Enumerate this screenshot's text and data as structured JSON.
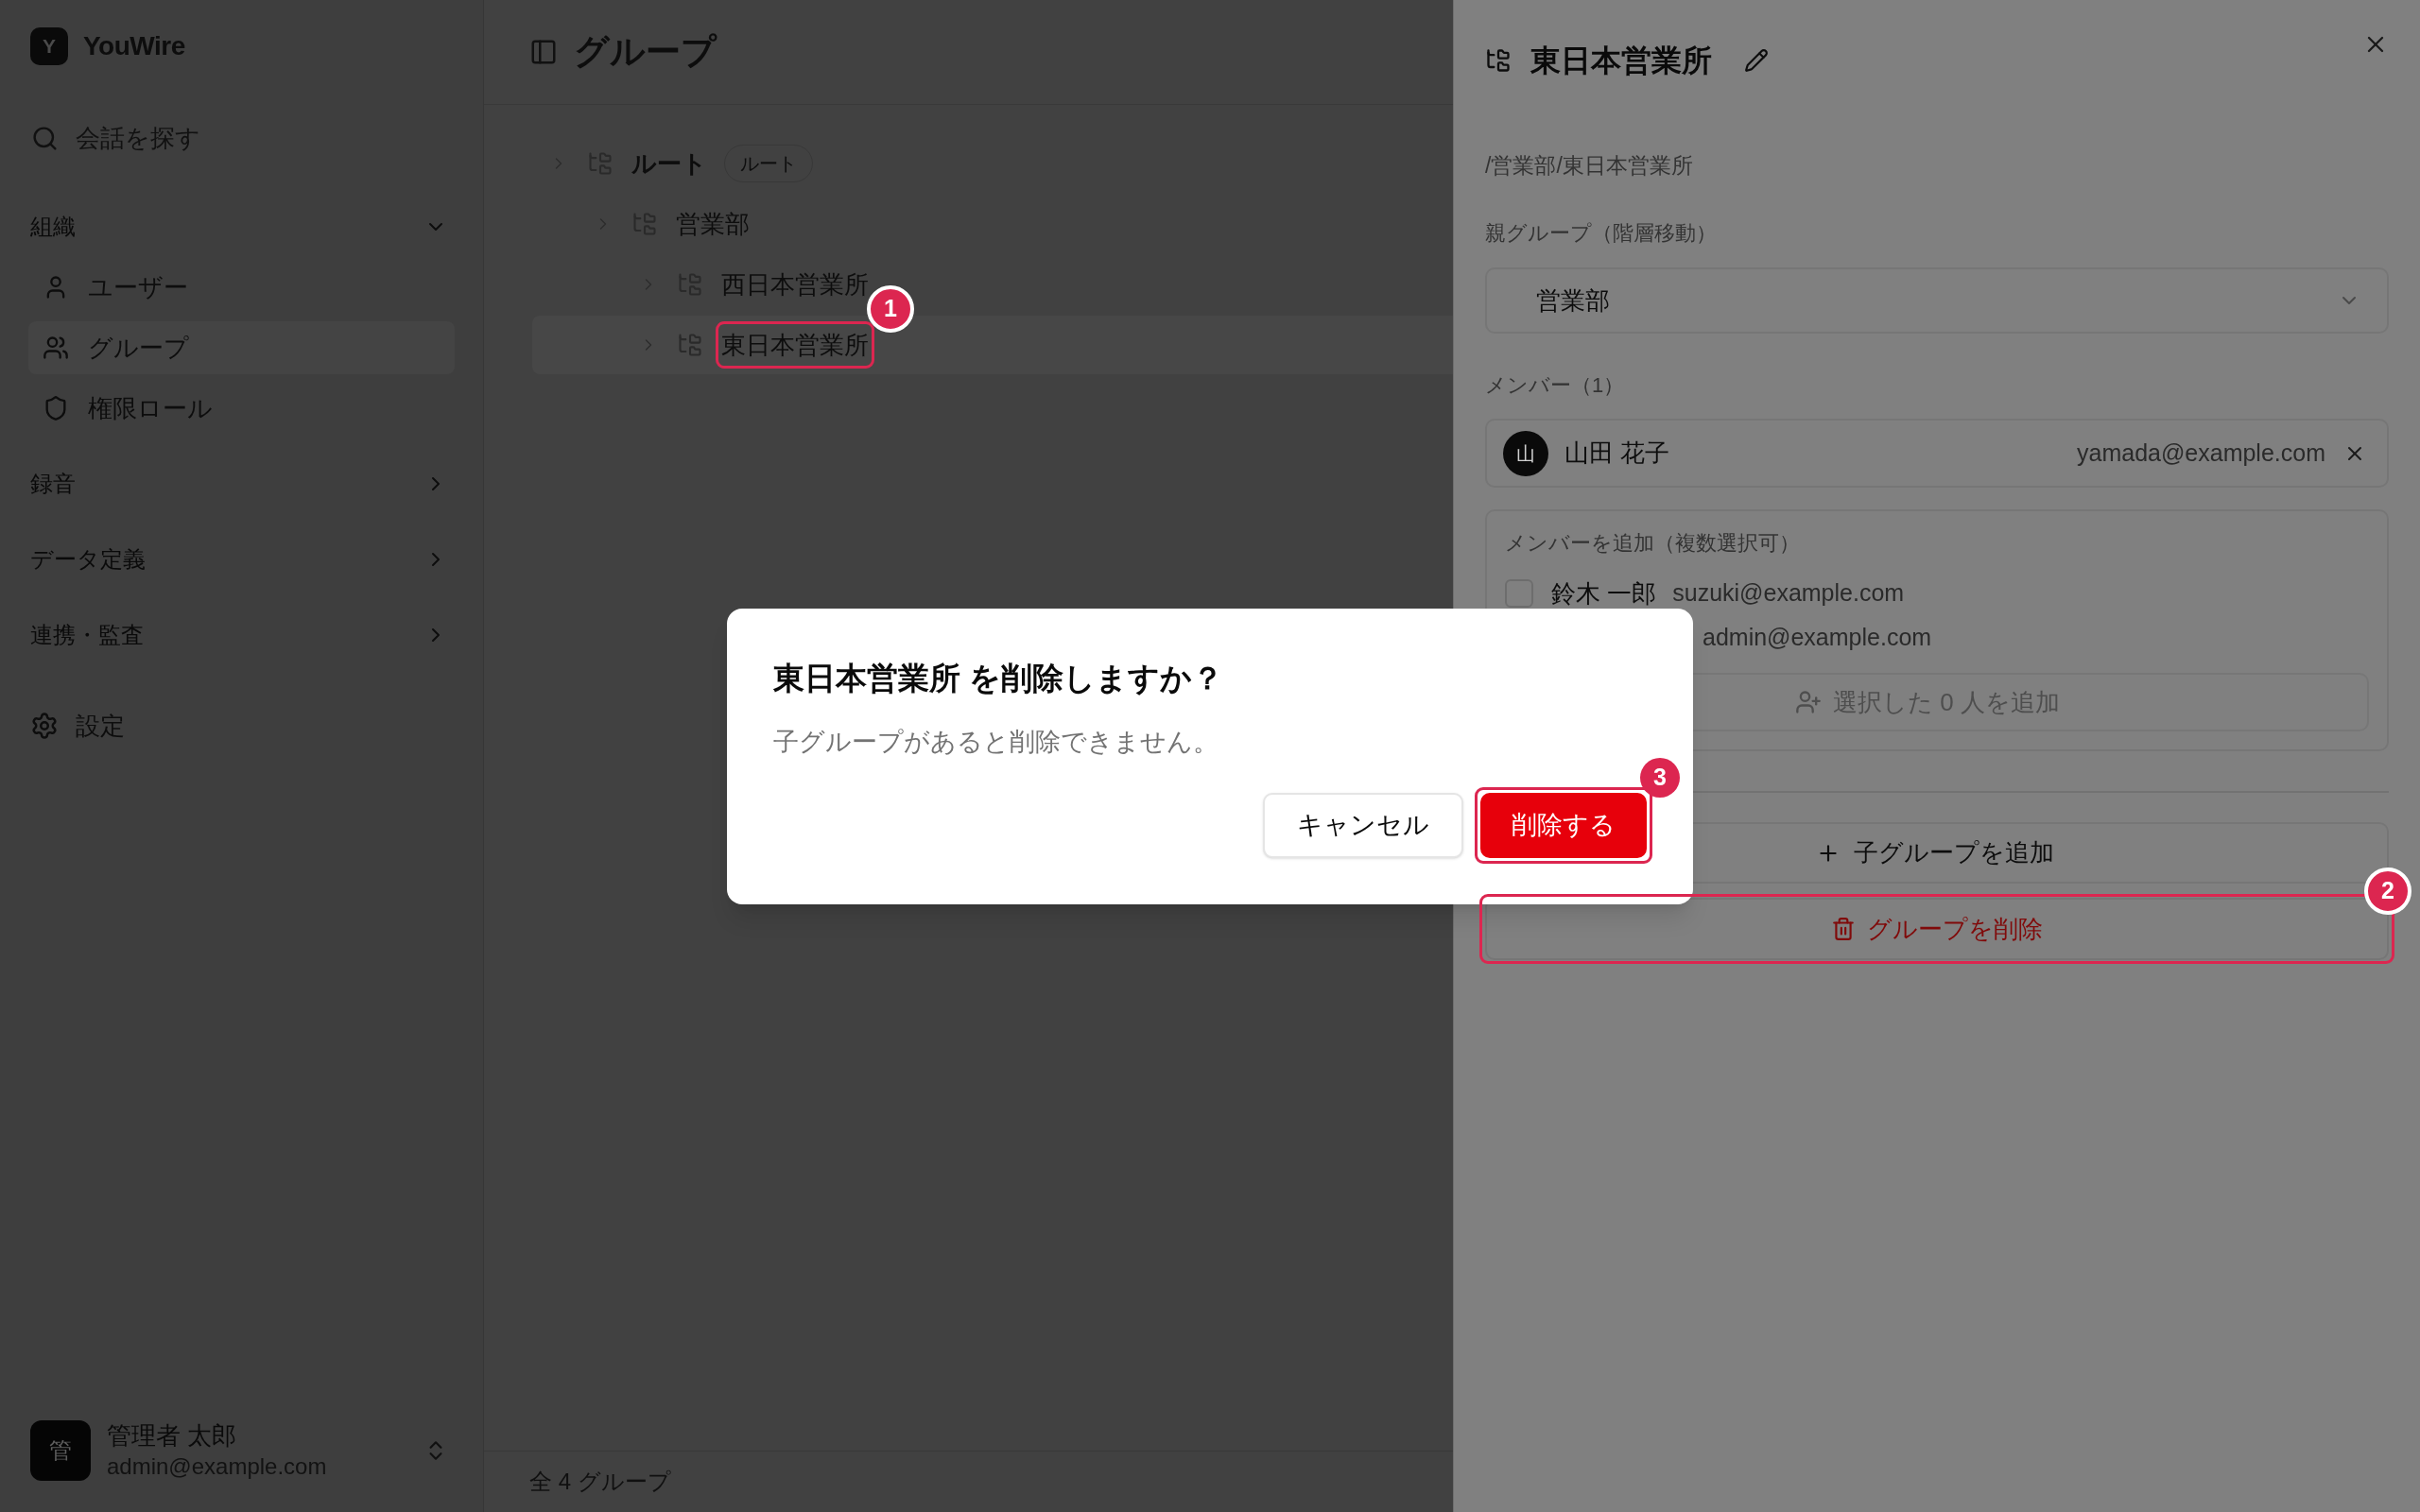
{
  "sidebar": {
    "logo": {
      "letter": "Y",
      "name": "YouWire"
    },
    "search": {
      "label": "会話を探す"
    },
    "sections": [
      {
        "label": "組織",
        "expanded": true,
        "items": [
          {
            "label": "ユーザー",
            "selected": false
          },
          {
            "label": "グループ",
            "selected": true
          },
          {
            "label": "権限ロール",
            "selected": false
          }
        ]
      },
      {
        "label": "録音",
        "expanded": false
      },
      {
        "label": "データ定義",
        "expanded": false
      },
      {
        "label": "連携・監査",
        "expanded": false
      }
    ],
    "settings": {
      "label": "設定"
    },
    "user": {
      "initial": "管",
      "name": "管理者 太郎",
      "email": "admin@example.com"
    }
  },
  "main": {
    "title": "グループ",
    "tree": [
      {
        "label": "ルート",
        "badge": "ルート",
        "selected": false,
        "children": [
          {
            "label": "営業部",
            "selected": false,
            "children": [
              {
                "label": "西日本営業所",
                "selected": false
              },
              {
                "label": "東日本営業所",
                "selected": true
              }
            ]
          }
        ]
      }
    ],
    "status_bar": "全 4 グループ"
  },
  "sheet": {
    "title": "東日本営業所",
    "path": "/営業部/東日本営業所",
    "parent_group": {
      "label": "親グループ（階層移動）",
      "value": "営業部"
    },
    "members": {
      "label": "メンバー（1）",
      "items": [
        {
          "initial": "山",
          "name": "山田 花子",
          "email": "yamada@example.com"
        }
      ]
    },
    "add_members": {
      "label": "メンバーを追加（複数選択可）",
      "candidates": [
        {
          "name": "鈴木 一郎",
          "email": "suzuki@example.com",
          "checked": false
        },
        {
          "email": "admin@example.com"
        }
      ],
      "button": {
        "label": "選択した 0 人を追加",
        "disabled": true
      }
    },
    "add_child_button": "子グループを追加",
    "delete_button": "グループを削除"
  },
  "dialog": {
    "title": "東日本営業所 を削除しますか？",
    "description": "子グループがあると削除できません。",
    "buttons": [
      {
        "label": "キャンセル",
        "kind": "secondary"
      },
      {
        "label": "削除する",
        "kind": "destructive"
      }
    ]
  },
  "annotations": [
    {
      "number": "1"
    },
    {
      "number": "2"
    },
    {
      "number": "3"
    }
  ]
}
